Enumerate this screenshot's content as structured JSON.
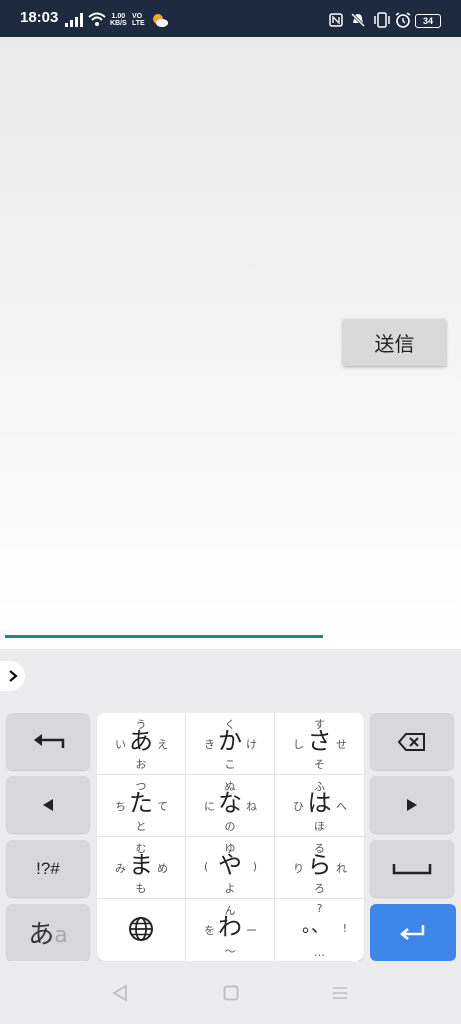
{
  "status_bar": {
    "time": "18:03",
    "net_speed_value": "1.00",
    "net_speed_unit": "KB/S",
    "volte_top": "VO",
    "volte_bottom": "LTE",
    "battery": "34",
    "icons": [
      "signal-icon",
      "wifi-icon",
      "weather-icon",
      "nfc-icon",
      "mute-icon",
      "vibrate-icon",
      "alarm-icon",
      "battery-icon"
    ]
  },
  "app": {
    "send_button_label": "送信",
    "input_value": ""
  },
  "keyboard": {
    "rows": [
      [
        {
          "main": "あ",
          "up": "う",
          "down": "お",
          "left": "い",
          "right": "え"
        },
        {
          "main": "か",
          "up": "く",
          "down": "こ",
          "left": "き",
          "right": "け"
        },
        {
          "main": "さ",
          "up": "す",
          "down": "そ",
          "left": "し",
          "right": "せ"
        }
      ],
      [
        {
          "main": "た",
          "up": "つ",
          "down": "と",
          "left": "ち",
          "right": "て"
        },
        {
          "main": "な",
          "up": "ぬ",
          "down": "の",
          "left": "に",
          "right": "ね"
        },
        {
          "main": "は",
          "up": "ふ",
          "down": "ほ",
          "left": "ひ",
          "right": "へ"
        }
      ],
      [
        {
          "main": "ま",
          "up": "む",
          "down": "も",
          "left": "み",
          "right": "め"
        },
        {
          "main": "や",
          "up": "ゆ",
          "down": "よ",
          "left": "(",
          "right": ")"
        },
        {
          "main": "ら",
          "up": "る",
          "down": "ろ",
          "left": "り",
          "right": "れ"
        }
      ]
    ],
    "wa_key": {
      "main": "わ",
      "up": "ん",
      "down": "〜",
      "left": "を",
      "right": "ー"
    },
    "punct_key": {
      "main": "。、",
      "up": "?",
      "down": "…",
      "right": "!"
    },
    "symbols_label": "!?#",
    "mode_main": "あ",
    "mode_alt": "a",
    "accent_color": "#3f86ea",
    "input_underline_color": "#1a8a87"
  }
}
